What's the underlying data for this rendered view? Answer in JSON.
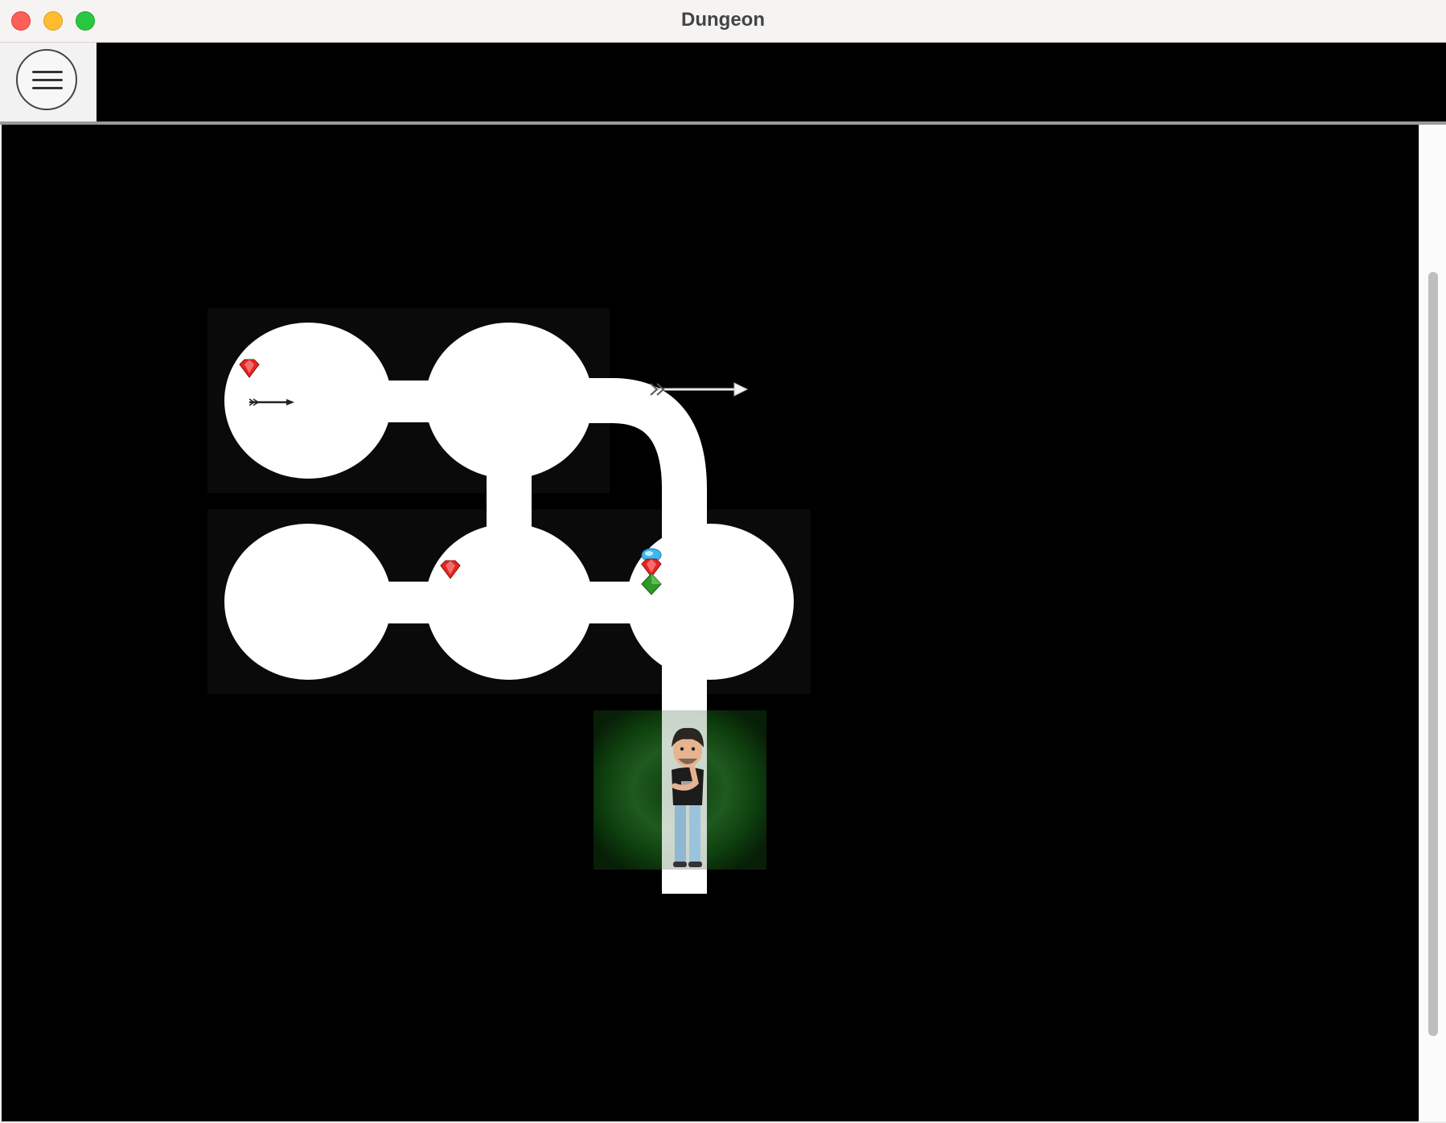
{
  "window": {
    "title": "Dungeon"
  },
  "toolbar": {
    "menu_icon": "hamburger-menu-icon"
  },
  "colors": {
    "background": "#000000",
    "path": "#ffffff",
    "ruby": "#e8231f",
    "sapphire": "#3fb6f0",
    "emerald": "#2f9a2a",
    "slime": "#1f5a1f"
  },
  "map": {
    "grid_cols": 3,
    "grid_rows": 3,
    "caves": [
      {
        "row": 0,
        "col": 0,
        "items": [
          "ruby",
          "arrow"
        ]
      },
      {
        "row": 0,
        "col": 1,
        "items": []
      },
      {
        "row": 1,
        "col": 0,
        "items": []
      },
      {
        "row": 1,
        "col": 1,
        "items": [
          "ruby"
        ]
      },
      {
        "row": 1,
        "col": 2,
        "items": [
          "sapphire",
          "ruby",
          "emerald"
        ]
      }
    ],
    "tunnels": [
      {
        "from": [
          0,
          0
        ],
        "to": [
          0,
          1
        ]
      },
      {
        "from": [
          0,
          1
        ],
        "to": [
          1,
          1
        ]
      },
      {
        "from": [
          0,
          1
        ],
        "to": [
          1,
          2
        ],
        "shape": "curve"
      },
      {
        "from": [
          1,
          0
        ],
        "to": [
          1,
          1
        ]
      },
      {
        "from": [
          1,
          1
        ],
        "to": [
          1,
          2
        ]
      },
      {
        "from": [
          1,
          2
        ],
        "to": [
          2,
          2
        ]
      }
    ],
    "player": {
      "row": 2,
      "col": 2,
      "smell": "nearby-monster"
    },
    "tunnel_arrow": {
      "row": 0,
      "col": 1,
      "direction": "east"
    }
  }
}
